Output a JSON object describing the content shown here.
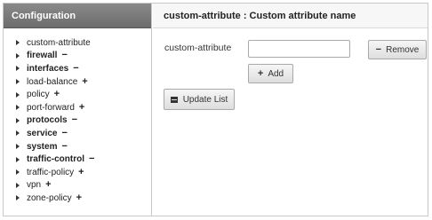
{
  "sidebar": {
    "title": "Configuration",
    "items": [
      {
        "label": "custom-attribute",
        "sign": "",
        "bold": false
      },
      {
        "label": "firewall",
        "sign": "−",
        "bold": true
      },
      {
        "label": "interfaces",
        "sign": "−",
        "bold": true
      },
      {
        "label": "load-balance",
        "sign": "+",
        "bold": false
      },
      {
        "label": "policy",
        "sign": "+",
        "bold": false
      },
      {
        "label": "port-forward",
        "sign": "+",
        "bold": false
      },
      {
        "label": "protocols",
        "sign": "−",
        "bold": true
      },
      {
        "label": "service",
        "sign": "−",
        "bold": true
      },
      {
        "label": "system",
        "sign": "−",
        "bold": true
      },
      {
        "label": "traffic-control",
        "sign": "−",
        "bold": true
      },
      {
        "label": "traffic-policy",
        "sign": "+",
        "bold": false
      },
      {
        "label": "vpn",
        "sign": "+",
        "bold": false
      },
      {
        "label": "zone-policy",
        "sign": "+",
        "bold": false
      }
    ]
  },
  "main": {
    "header": "custom-attribute : Custom attribute name",
    "field_label": "custom-attribute",
    "field_value": "",
    "field_placeholder": "",
    "remove_label": "Remove",
    "add_label": "Add",
    "update_label": "Update List"
  }
}
